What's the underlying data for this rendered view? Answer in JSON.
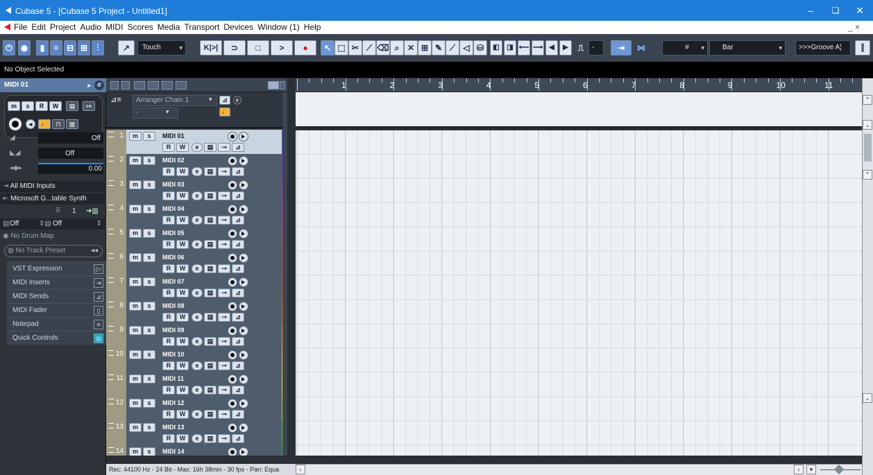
{
  "window": {
    "title": "Cubase 5 - [Cubase 5 Project - Untitled1]",
    "minimize": "–",
    "maximize": "❏",
    "close": "✕"
  },
  "menu": {
    "items": [
      "File",
      "Edit",
      "Project",
      "Audio",
      "MIDI",
      "Scores",
      "Media",
      "Transport",
      "Devices",
      "Window (1)",
      "Help"
    ],
    "controls": "_ ×"
  },
  "toolbar": {
    "automation_mode": "Touch",
    "snap_type": "Bar",
    "quantize_preset": ">>>Groove A¦",
    "grid_symbol": "#",
    "goto_start": "K|>|",
    "cycle": "⊃",
    "stop": "□",
    "play": ">",
    "record": "●"
  },
  "object_status": "No Object Selected",
  "inspector": {
    "track_name": "MIDI 01",
    "volume_value": "Off",
    "pan_value": "Off",
    "delay_value": "0.00",
    "input": "All MIDI Inputs",
    "output": "Microsoft G...table Synth",
    "channel": "1",
    "bank": "Off",
    "program": "Off",
    "drum_map": "No Drum Map",
    "track_preset": "No Track Preset",
    "sections": [
      "VST Expression",
      "MIDI Inserts",
      "MIDI Sends",
      "MIDI Fader",
      "Notepad",
      "Quick Controls"
    ]
  },
  "arranger": {
    "chain": "Arranger Chain 1",
    "sub": "-"
  },
  "tracks": [
    {
      "num": "1",
      "name": "MIDI 01",
      "color": "#3f5bd6",
      "selected": true
    },
    {
      "num": "2",
      "name": "MIDI 02",
      "color": "#6c3fd6",
      "selected": false
    },
    {
      "num": "3",
      "name": "MIDI 03",
      "color": "#9a3fc9",
      "selected": false
    },
    {
      "num": "4",
      "name": "MIDI 04",
      "color": "#c23aa8",
      "selected": false
    },
    {
      "num": "5",
      "name": "MIDI 05",
      "color": "#d63f6b",
      "selected": false
    },
    {
      "num": "6",
      "name": "MIDI 06",
      "color": "#d6433f",
      "selected": false
    },
    {
      "num": "7",
      "name": "MIDI 07",
      "color": "#e4583a",
      "selected": false
    },
    {
      "num": "8",
      "name": "MIDI 08",
      "color": "#ea7b35",
      "selected": false
    },
    {
      "num": "9",
      "name": "MIDI 09",
      "color": "#eea236",
      "selected": false
    },
    {
      "num": "10",
      "name": "MIDI 10",
      "color": "#f1c93a",
      "selected": false
    },
    {
      "num": "11",
      "name": "MIDI 11",
      "color": "#e6e23c",
      "selected": false
    },
    {
      "num": "12",
      "name": "MIDI 12",
      "color": "#a7d83b",
      "selected": false
    },
    {
      "num": "13",
      "name": "MIDI 13",
      "color": "#62c44a",
      "selected": false
    },
    {
      "num": "14",
      "name": "MIDI 14",
      "color": "#3faa4e",
      "selected": false
    }
  ],
  "track_buttons": {
    "mute": "m",
    "solo": "s",
    "read": "R",
    "write": "W"
  },
  "ruler": {
    "bars": [
      "1",
      "2",
      "3",
      "4",
      "5",
      "6",
      "7",
      "8",
      "9",
      "10",
      "11"
    ]
  },
  "statusbar": "Rec: 44100 Hz - 24 Bit - Max: 16h 38min - 30 fps - Pan: Equa"
}
